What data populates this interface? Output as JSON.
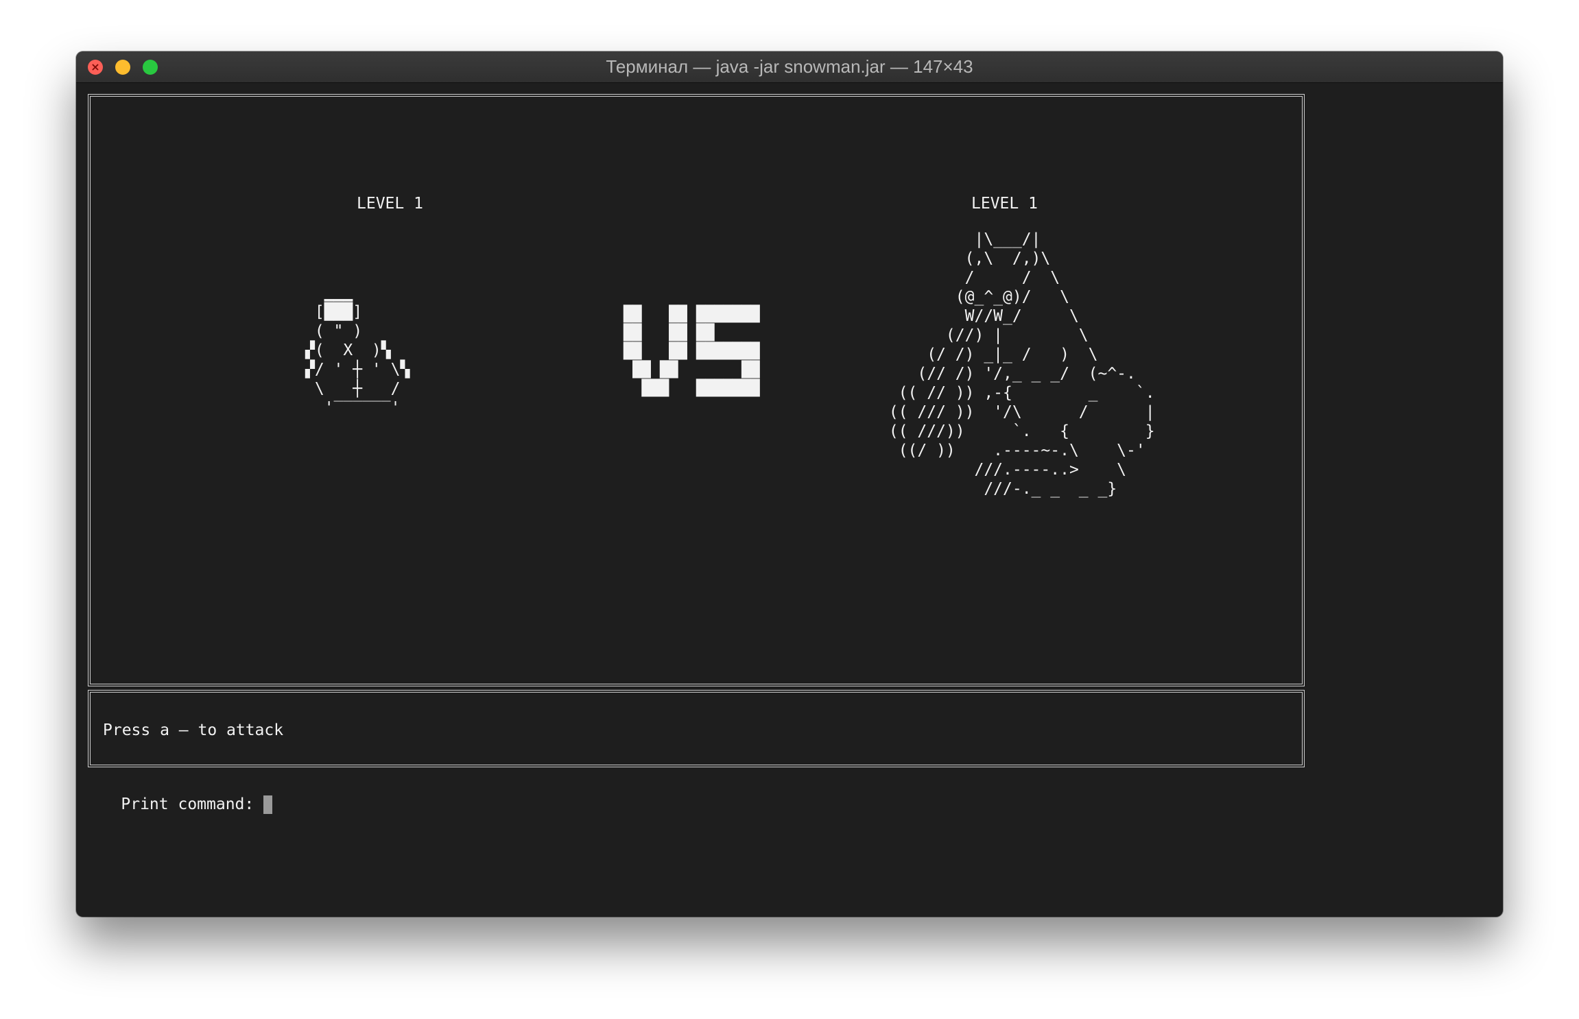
{
  "window": {
    "title": "Терминал — java -jar snowman.jar — 147×43",
    "close_glyph": "×"
  },
  "game": {
    "player": {
      "level": "LEVEL 1",
      "art": "  ▁▁▁\n [███]\n ( \" )\n▞(  X  )▚\n▞/ ' ┼ ' \\▚\n \\   ┼   /\n  '‾‾‾‾‾‾'"
    },
    "versus": {
      "art": "██   ██ ███████\n██   ██ ██\n██   ██ ███████\n ██ ██       ██\n  ███   ███████"
    },
    "enemy": {
      "level": "LEVEL 1",
      "art": "          |\\___/|\n         (,\\  /,)\\\n         /     /  \\\n        (@_^_@)/   \\\n         W//W_/     \\\n       (//) |        \\\n     (/ /) _|_ /   )  \\\n    (// /) '/,_ _ _/  (~^-.\n  (( // )) ,-{        _    `.\n (( /// ))  '/\\      /      |\n (( ///))     `.   {        }\n  ((/ ))    .----~-.\\    \\-'\n          ///.----..>    \\\n           ///-._ _  _ _}"
    }
  },
  "message": {
    "text": "Press a – to attack"
  },
  "prompt": {
    "label": "Print command:"
  }
}
